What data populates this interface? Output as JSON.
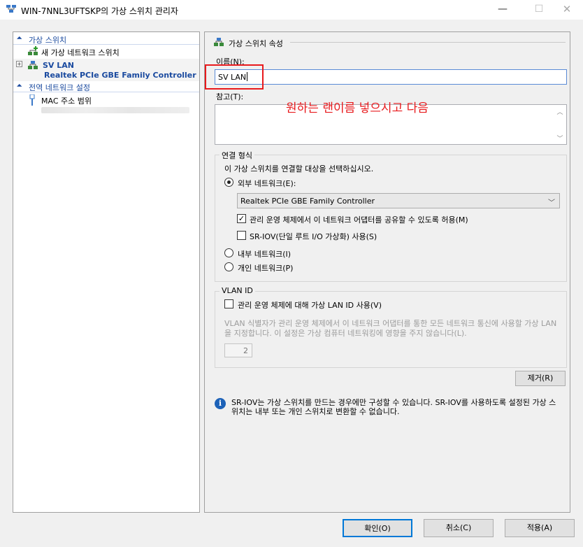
{
  "window": {
    "title": "WIN-7NNL3UFTSKP의 가상 스위치 관리자",
    "min_glyph": "—",
    "max_glyph": "☐",
    "close_glyph": "✕"
  },
  "left": {
    "section_switches": "가상 스위치",
    "new_switch": "새 가상 네트워크 스위치",
    "sv_name": "SV LAN",
    "sv_adapter": "Realtek PCIe GBE Family Controller",
    "section_global": "전역 네트워크 설정",
    "mac_range": "MAC 주소 범위",
    "expander": "+",
    "arrow": "⏶"
  },
  "right": {
    "header": "가상 스위치 속성",
    "name_label": "이름(N):",
    "name_value": "SV LAN",
    "notes_label": "참고(T):",
    "annotation": "원하는 랜이름 넣으시고 다음",
    "conn_group": "연결 형식",
    "conn_desc": "이 가상 스위치를 연결할 대상을 선택하십시오.",
    "external": "외부 네트워크(E):",
    "adapter_selected": "Realtek PCIe GBE Family Controller",
    "allow_share": "관리 운영 체제에서 이 네트워크 어댑터를 공유할 수 있도록 허용(M)",
    "sriov": "SR-IOV(단일 루트 I/O 가상화) 사용(S)",
    "internal": "내부 네트워크(I)",
    "private": "개인 네트워크(P)",
    "vlan_group": "VLAN ID",
    "vlan_enable": "관리 운영 체제에 대해 가상 LAN ID 사용(V)",
    "vlan_desc": "VLAN 식별자가 관리 운영 체제에서 이 네트워크 어댑터를 통한 모든 네트워크 통신에 사용할 가상 LAN을 지정합니다. 이 설정은 가상 컴퓨터 네트워킹에 영향을 주지 않습니다(L).",
    "vlan_id": "2",
    "remove": "제거(R)",
    "info": "SR-IOV는 가상 스위치를 만드는 경우에만 구성할 수 있습니다. SR-IOV를 사용하도록 설정된 가상 스위치는 내부 또는 개인 스위치로 변환할 수 없습니다.",
    "info_glyph": "i",
    "check_glyph": "✓"
  },
  "footer": {
    "ok": "확인(O)",
    "cancel": "취소(C)",
    "apply": "적용(A)"
  }
}
